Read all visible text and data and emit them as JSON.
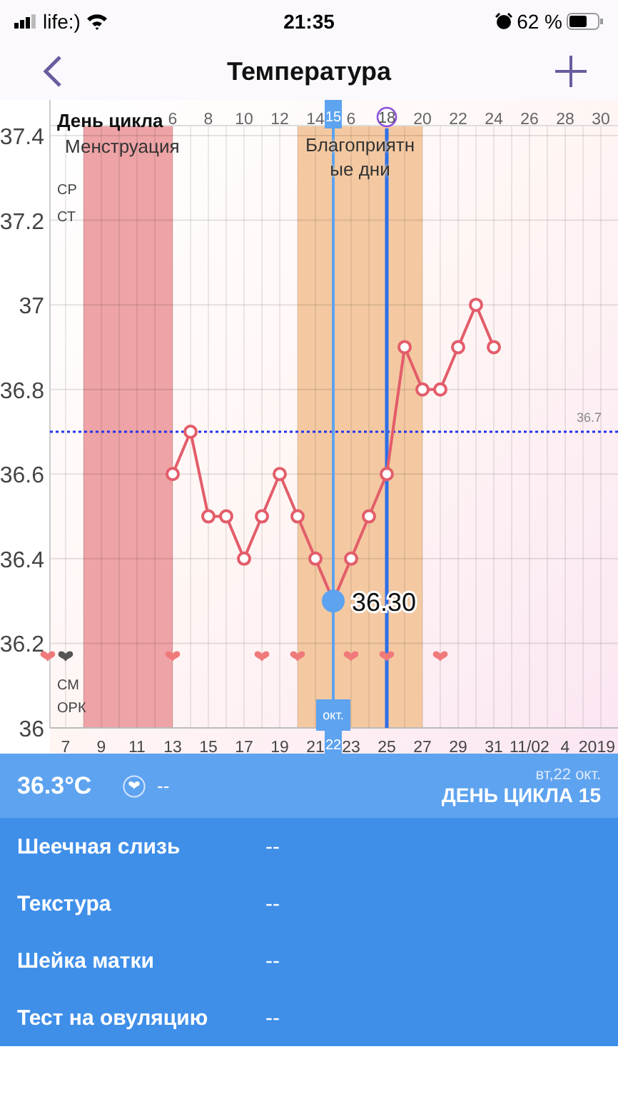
{
  "status_bar": {
    "carrier": "life:)",
    "time": "21:35",
    "battery": "62 %"
  },
  "nav": {
    "title": "Температура"
  },
  "chart": {
    "axis_title": "День цикла",
    "cycle_day_labels": [
      {
        "text": "6",
        "marked": false
      },
      {
        "text": "8",
        "marked": false
      },
      {
        "text": "10",
        "marked": false
      },
      {
        "text": "12",
        "marked": false
      },
      {
        "text": "14",
        "marked": false
      },
      {
        "text": "6",
        "marked": false
      },
      {
        "text": "18",
        "marked": true
      },
      {
        "text": "20",
        "marked": false
      },
      {
        "text": "22",
        "marked": false
      },
      {
        "text": "24",
        "marked": false
      },
      {
        "text": "26",
        "marked": false
      },
      {
        "text": "28",
        "marked": false
      },
      {
        "text": "30",
        "marked": false
      }
    ],
    "selected_day": {
      "cycle_day": "15",
      "month": "окт.",
      "date": "22"
    },
    "axis_end_labels": [
      "4",
      "2019"
    ],
    "side_labels_top": [
      "СР",
      "СТ"
    ],
    "side_labels_bottom": [
      "СМ",
      "ОРК"
    ],
    "intercourse": [
      {
        "marked": true,
        "color": "#f07a7a"
      },
      {
        "marked": true,
        "color": "#555555"
      },
      {
        "marked": false
      },
      {
        "marked": false
      },
      {
        "marked": false
      },
      {
        "marked": false
      },
      {
        "marked": false
      },
      {
        "marked": true,
        "color": "#f07a7a"
      },
      {
        "marked": false
      },
      {
        "marked": false
      },
      {
        "marked": false
      },
      {
        "marked": false
      },
      {
        "marked": true,
        "color": "#f07a7a"
      },
      {
        "marked": false
      },
      {
        "marked": true,
        "color": "#f07a7a"
      },
      {
        "marked": false
      },
      {
        "marked": false
      },
      {
        "marked": true,
        "color": "#f07a7a"
      },
      {
        "marked": false
      },
      {
        "marked": true,
        "color": "#f07a7a"
      },
      {
        "marked": false
      },
      {
        "marked": false
      },
      {
        "marked": true,
        "color": "#f07a7a"
      }
    ],
    "chart_data": {
      "type": "line",
      "xlim": [
        6.12,
        37.96
      ],
      "ylim": [
        36,
        37.4
      ],
      "grid": true,
      "yticks": [
        36,
        36.2,
        36.4,
        36.6,
        36.8,
        37,
        37.2,
        37.4
      ],
      "xticks": [
        7,
        9,
        11,
        13,
        15,
        17,
        19,
        21,
        23,
        25,
        27,
        29,
        31,
        {
          "value": 33,
          "label": "11/02"
        }
      ],
      "x": [
        13,
        14,
        15,
        16,
        17,
        18,
        19,
        20,
        21,
        22,
        23,
        24,
        25,
        26,
        27,
        28,
        29,
        30,
        31
      ],
      "series": [
        {
          "color": "#e35d6a",
          "marker": "circle",
          "values": [
            36.6,
            36.7,
            36.5,
            36.5,
            36.4,
            36.5,
            36.6,
            36.5,
            36.4,
            36.3,
            36.4,
            36.5,
            36.6,
            36.9,
            36.8,
            36.8,
            36.9,
            37.0,
            36.9
          ]
        }
      ],
      "bands": [
        {
          "axis": "x",
          "from": 8,
          "to": 13,
          "label": "Менструация",
          "color": "#eea3a6"
        },
        {
          "axis": "x",
          "from": 20,
          "to": 27,
          "label": "Благоприятные дни",
          "color": "#f4c9a2"
        }
      ],
      "ref_lines": [
        {
          "axis": "y",
          "value": 36.7,
          "label": "36.7",
          "color": "#2233ee"
        },
        {
          "axis": "x",
          "value": 22,
          "color": "#5da3f0"
        },
        {
          "axis": "x",
          "value": 25,
          "color": "#2f6fe6"
        }
      ],
      "annotations": [
        {
          "x": 22,
          "y": 36.3,
          "text": "36.30"
        }
      ]
    }
  },
  "summary": {
    "temperature": "36.3°C",
    "sex": "--",
    "date": "вт,22 окт.",
    "cycle_day": "ДЕНЬ ЦИКЛА 15"
  },
  "rows": [
    {
      "label": "Шеечная слизь",
      "value": "--"
    },
    {
      "label": "Текстура",
      "value": "--"
    },
    {
      "label": "Шейка матки",
      "value": "--"
    },
    {
      "label": "Тест на овуляцию",
      "value": "--"
    }
  ]
}
